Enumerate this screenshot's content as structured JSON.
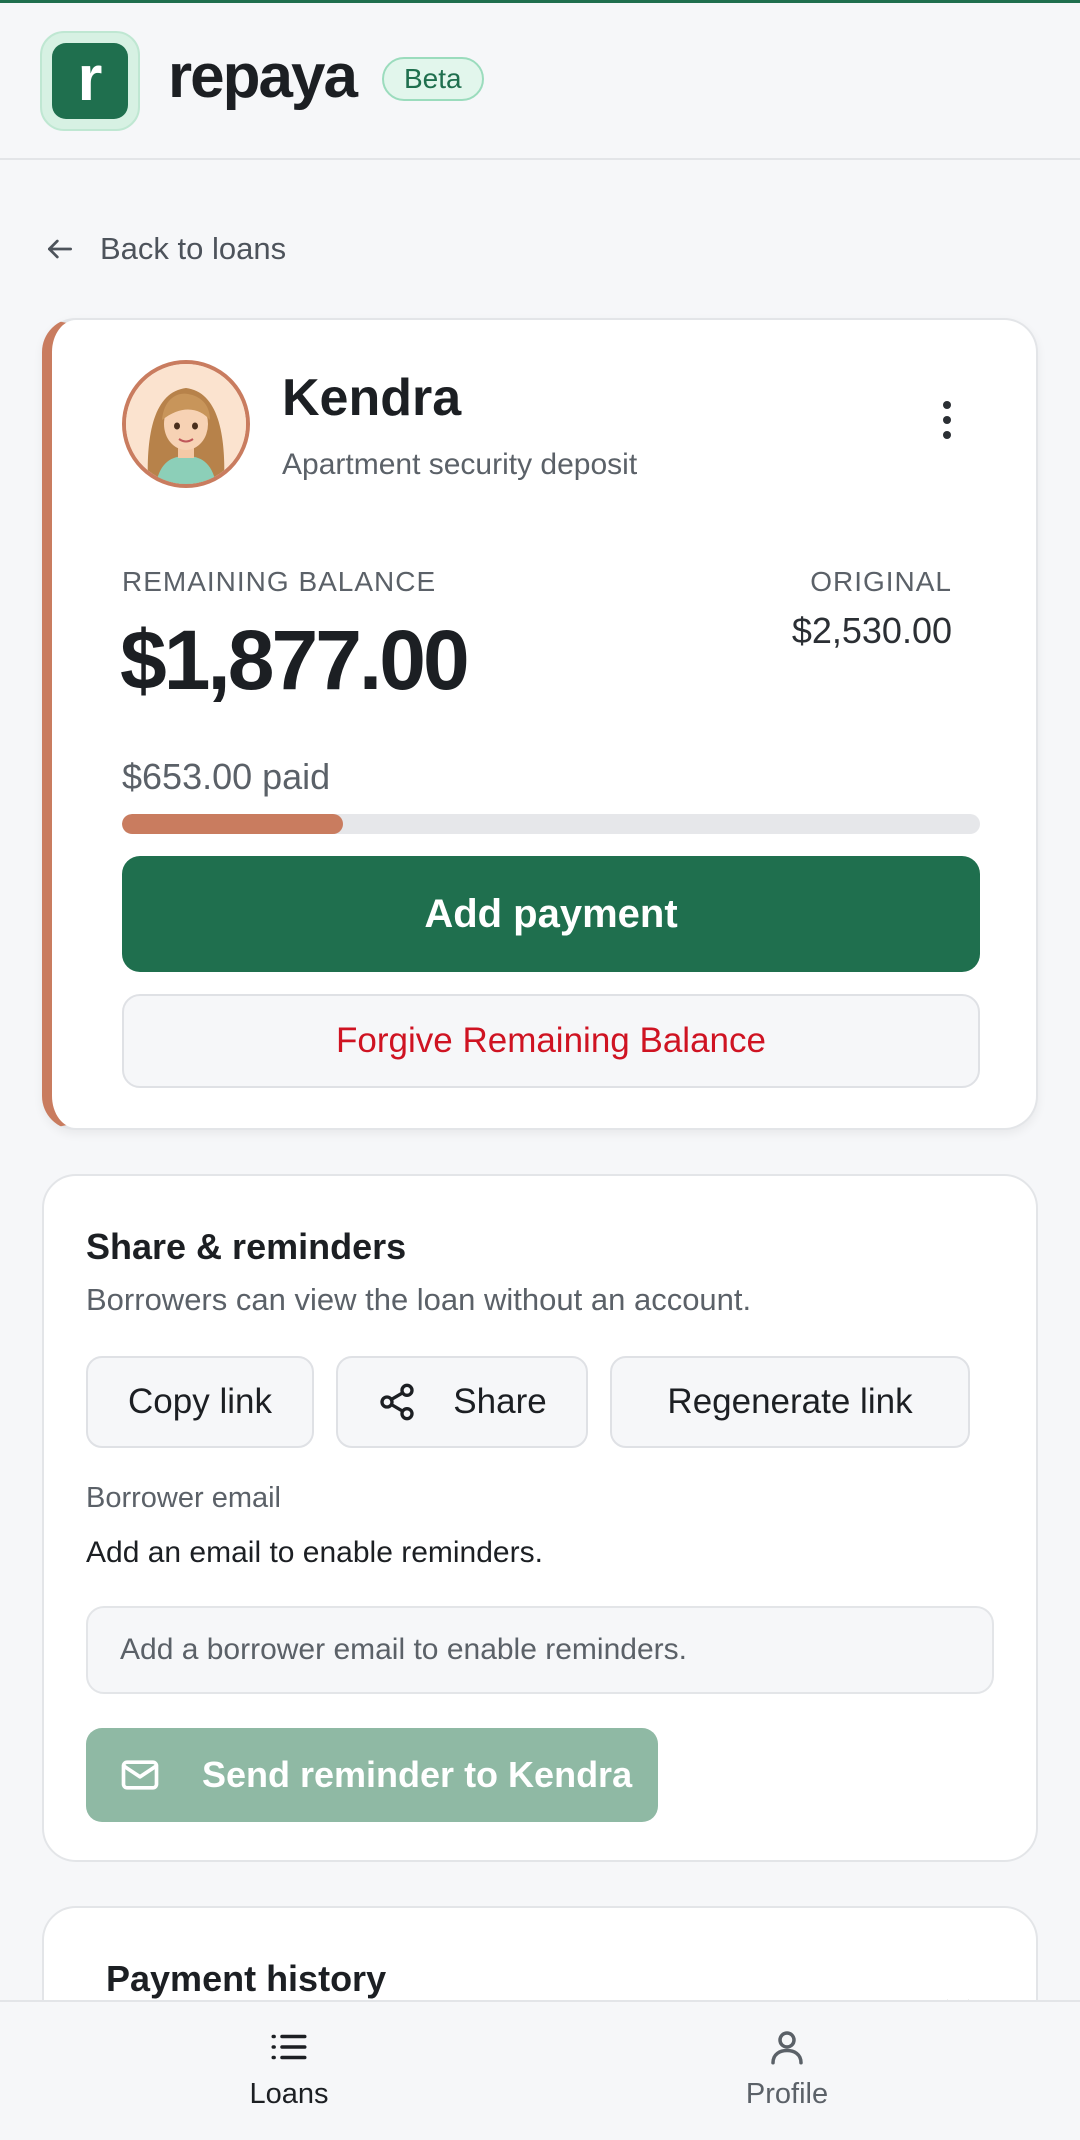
{
  "app": {
    "brand": "repaya",
    "logo_letter": "r",
    "badge": "Beta",
    "accent_color": "#1f6f4e"
  },
  "nav": {
    "back_label": "Back to loans"
  },
  "loan": {
    "borrower_name": "Kendra",
    "purpose": "Apartment security deposit",
    "remaining_label": "REMAINING BALANCE",
    "remaining_value": "$1,877.00",
    "original_label": "ORIGINAL",
    "original_value": "$2,530.00",
    "paid_text": "$653.00 paid",
    "paid_fraction": 0.258,
    "accent_color": "#c97c5f",
    "add_payment_label": "Add payment",
    "forgive_label": "Forgive Remaining Balance"
  },
  "share": {
    "title": "Share & reminders",
    "description": "Borrowers can view the loan without an account.",
    "copy_label": "Copy link",
    "share_label": "Share",
    "regenerate_label": "Regenerate link",
    "email_label": "Borrower email",
    "email_hint": "Add an email to enable reminders.",
    "email_placeholder": "Add a borrower email to enable reminders.",
    "send_reminder_label": "Send reminder to Kendra"
  },
  "history": {
    "title": "Payment history"
  },
  "bottom_nav": {
    "loans_label": "Loans",
    "profile_label": "Profile"
  }
}
